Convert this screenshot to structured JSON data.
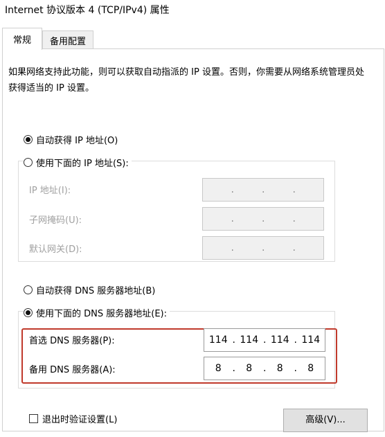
{
  "window": {
    "title": "Internet 协议版本 4 (TCP/IPv4) 属性"
  },
  "tabs": [
    {
      "label": "常规",
      "selected": true
    },
    {
      "label": "备用配置",
      "selected": false
    }
  ],
  "description": "如果网络支持此功能，则可以获取自动指派的 IP 设置。否则，你需要从网络系统管理员处获得适当的 IP 设置。",
  "ip_section": {
    "auto_option": {
      "label": "自动获得 IP 地址(O)",
      "selected": true
    },
    "manual_option": {
      "label": "使用下面的 IP 地址(S):",
      "selected": false
    },
    "fields": {
      "ip_address": {
        "label": "IP 地址(I):",
        "octets": [
          "",
          "",
          "",
          ""
        ]
      },
      "subnet_mask": {
        "label": "子网掩码(U):",
        "octets": [
          "",
          "",
          "",
          ""
        ]
      },
      "default_gateway": {
        "label": "默认网关(D):",
        "octets": [
          "",
          "",
          "",
          ""
        ]
      }
    }
  },
  "dns_section": {
    "auto_option": {
      "label": "自动获得 DNS 服务器地址(B)",
      "selected": false
    },
    "manual_option": {
      "label": "使用下面的 DNS 服务器地址(E):",
      "selected": true
    },
    "preferred": {
      "label": "首选 DNS 服务器(P):",
      "octets": [
        "114",
        "114",
        "114",
        "114"
      ]
    },
    "alternate": {
      "label": "备用 DNS 服务器(A):",
      "octets": [
        "8",
        "8",
        "8",
        "8"
      ]
    }
  },
  "validate_on_exit": {
    "label": "退出时验证设置(L)",
    "checked": false
  },
  "advanced_button": {
    "label": "高级(V)..."
  },
  "colors": {
    "highlight_frame": "#c0392b",
    "disabled_text": "#a0a0a0"
  }
}
